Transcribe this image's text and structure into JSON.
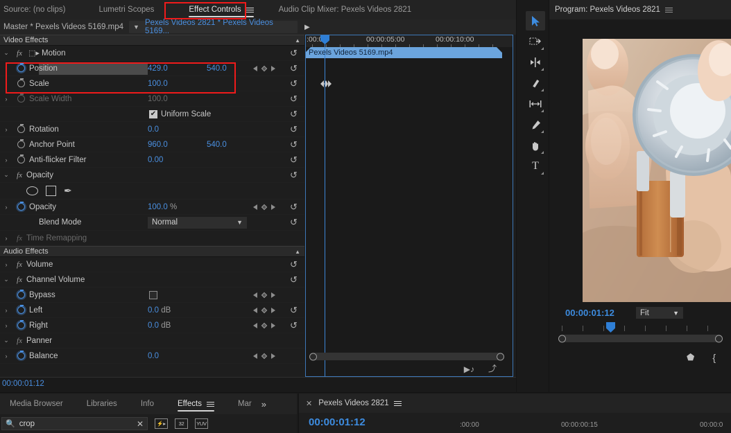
{
  "app": "Adobe Premiere Pro",
  "top_tabs": [
    {
      "label": "Source: (no clips)",
      "active": false,
      "menu": false
    },
    {
      "label": "Lumetri Scopes",
      "active": false,
      "menu": false
    },
    {
      "label": "Effect Controls",
      "active": true,
      "menu": true
    },
    {
      "label": "Audio Clip Mixer: Pexels Videos 2821",
      "active": false,
      "menu": false
    }
  ],
  "effect_controls": {
    "master_label": "Master * Pexels Videos 5169.mp4",
    "sequence_label": "Pexels Videos 2821 * Pexels Videos 5169...",
    "video_effects_header": "Video Effects",
    "audio_effects_header": "Audio Effects",
    "timecode": "00:00:01:12",
    "clip_name": "Pexels Videos 5169.mp4",
    "ruler_labels": [
      ":00:00",
      "00:00:05:00",
      "00:00:10:00"
    ],
    "video": [
      {
        "name": "Motion",
        "type": "effect",
        "fx": true,
        "expanded": true,
        "reset": true
      },
      {
        "name": "Position",
        "type": "param",
        "values": [
          "429.0",
          "540.0"
        ],
        "keyframable": true,
        "kfnav": true,
        "reset": true,
        "highlighted": true,
        "twirl": true,
        "stopwatch_on": true
      },
      {
        "name": "Scale",
        "type": "param",
        "values": [
          "100.0"
        ],
        "reset": true,
        "twirl": true,
        "stopwatch_on": false
      },
      {
        "name": "Scale Width",
        "type": "param",
        "values": [
          "100.0"
        ],
        "disabled": true,
        "reset": true,
        "twirl": true,
        "stopwatch_on": false
      },
      {
        "name": "Uniform Scale",
        "type": "checkbox",
        "checked": true,
        "reset": true
      },
      {
        "name": "Rotation",
        "type": "param",
        "values": [
          "0.0"
        ],
        "reset": true,
        "twirl": true,
        "stopwatch_on": false
      },
      {
        "name": "Anchor Point",
        "type": "param",
        "values": [
          "960.0",
          "540.0"
        ],
        "reset": true,
        "stopwatch_on": false
      },
      {
        "name": "Anti-flicker Filter",
        "type": "param",
        "values": [
          "0.00"
        ],
        "reset": true,
        "twirl": true,
        "stopwatch_on": false
      },
      {
        "name": "Opacity",
        "type": "effect",
        "fx": true,
        "expanded": true,
        "reset": true
      },
      {
        "name": "mask-tools",
        "type": "masktools",
        "tools": [
          "ellipse-mask",
          "rectangle-mask",
          "pen-mask"
        ]
      },
      {
        "name": "Opacity",
        "type": "param",
        "values": [
          "100.0"
        ],
        "unit": "%",
        "kfnav": true,
        "reset": true,
        "twirl": true,
        "stopwatch_on": true
      },
      {
        "name": "Blend Mode",
        "type": "select",
        "value": "Normal",
        "reset": true
      },
      {
        "name": "Time Remapping",
        "type": "effect",
        "fx": true,
        "expanded": false,
        "disabled": true,
        "twirl": true
      }
    ],
    "audio": [
      {
        "name": "Volume",
        "type": "effect",
        "fx": true,
        "expanded": false,
        "twirl": true,
        "reset": true
      },
      {
        "name": "Channel Volume",
        "type": "effect",
        "fx": true,
        "expanded": true,
        "reset": true
      },
      {
        "name": "Bypass",
        "type": "checkbox",
        "checked": false,
        "kfnav": true,
        "stopwatch_on": true
      },
      {
        "name": "Left",
        "type": "param",
        "values": [
          "0.0"
        ],
        "unit": "dB",
        "kfnav": true,
        "reset": true,
        "twirl": true,
        "stopwatch_on": true
      },
      {
        "name": "Right",
        "type": "param",
        "values": [
          "0.0"
        ],
        "unit": "dB",
        "kfnav": true,
        "reset": true,
        "twirl": true,
        "stopwatch_on": true
      },
      {
        "name": "Panner",
        "type": "effect",
        "fx": true,
        "expanded": true
      },
      {
        "name": "Balance",
        "type": "param",
        "values": [
          "0.0"
        ],
        "kfnav": true,
        "twirl": true,
        "stopwatch_on": true
      }
    ]
  },
  "tools": [
    {
      "name": "selection-tool",
      "glyph": "selection",
      "selected": true
    },
    {
      "name": "track-select-forward-tool",
      "glyph": "track-select",
      "selected": false
    },
    {
      "name": "ripple-edit-tool",
      "glyph": "ripple",
      "selected": false
    },
    {
      "name": "razor-tool",
      "glyph": "razor",
      "selected": false
    },
    {
      "name": "slip-tool",
      "glyph": "slip",
      "selected": false
    },
    {
      "name": "pen-tool",
      "glyph": "pen",
      "selected": false
    },
    {
      "name": "hand-tool",
      "glyph": "hand",
      "selected": false
    },
    {
      "name": "type-tool",
      "glyph": "type",
      "selected": false
    }
  ],
  "program_monitor": {
    "title": "Program: Pexels Videos 2821",
    "timecode": "00:00:01:12",
    "zoom_level": "Fit"
  },
  "bottom_left": {
    "tabs": [
      {
        "label": "Media Browser",
        "active": false,
        "menu": false
      },
      {
        "label": "Libraries",
        "active": false,
        "menu": false
      },
      {
        "label": "Info",
        "active": false,
        "menu": false
      },
      {
        "label": "Effects",
        "active": true,
        "menu": true
      },
      {
        "label": "Mar",
        "active": false,
        "menu": false
      }
    ],
    "overflow": "»",
    "search_value": "crop",
    "badges": [
      "accelerated",
      "32",
      "YUV"
    ]
  },
  "bottom_right": {
    "tab_label": "Pexels Videos 2821",
    "timecode": "00:00:01:12",
    "ruler_labels": [
      ":00:00",
      "00:00:00:15",
      "00:00:0"
    ]
  },
  "colors": {
    "accent_blue": "#4a8fe0",
    "annotation_red": "#f01b1b",
    "clip_blue": "#6ba4dd",
    "panel_bg": "#1e1e1e"
  }
}
